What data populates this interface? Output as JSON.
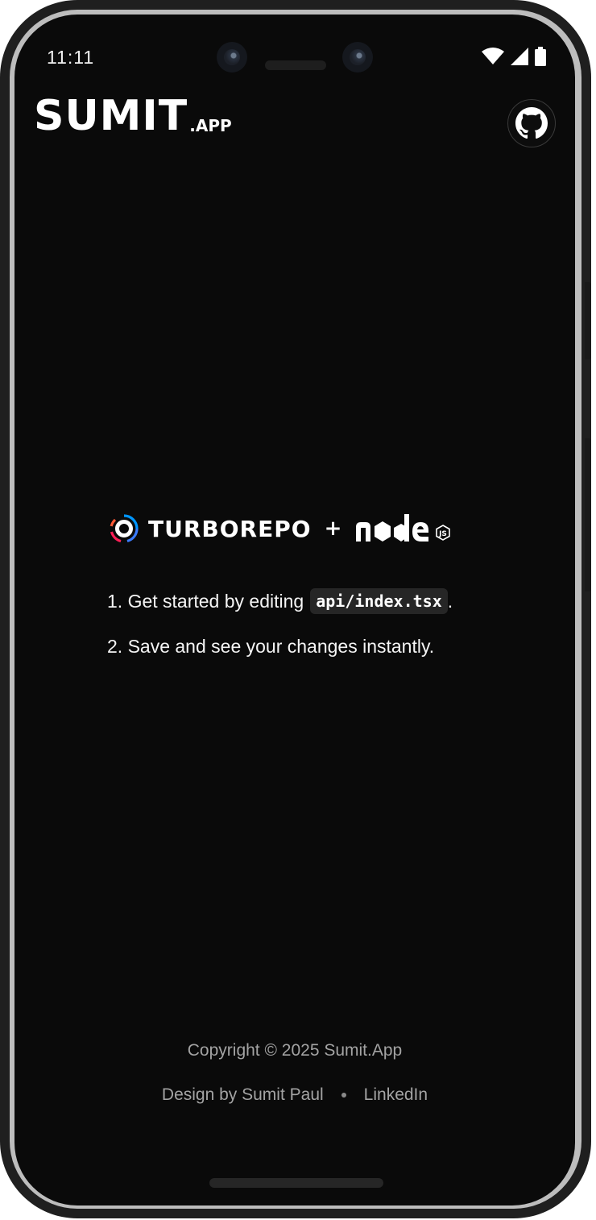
{
  "status_bar": {
    "time": "11:11"
  },
  "header": {
    "brand_main": "SUMIT",
    "brand_suffix": ".APP",
    "github_icon": "github-icon"
  },
  "hero": {
    "turborepo_label": "TURBOREPO",
    "plus": "+",
    "node_logo": "nodejs-logo"
  },
  "steps": [
    {
      "prefix": "1. Get started by editing",
      "code": "api/index.tsx",
      "suffix": "."
    },
    {
      "text": "2. Save and see your changes instantly."
    }
  ],
  "footer": {
    "copyright": "Copyright © 2025 Sumit.App",
    "design_credit": "Design by Sumit Paul",
    "linkedin": "LinkedIn"
  },
  "colors": {
    "background": "#0a0a0a",
    "text": "#ffffff",
    "muted": "#a3a3a3",
    "code_bg": "#262626",
    "turbo_blue": "#0096ff",
    "turbo_red": "#ff1e56"
  }
}
